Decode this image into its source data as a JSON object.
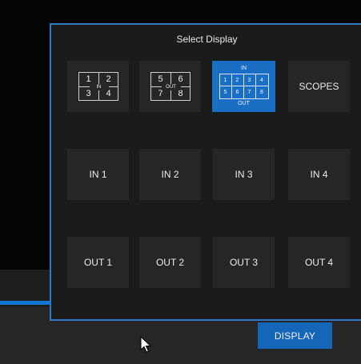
{
  "popup": {
    "title": "Select Display",
    "multiviews": [
      {
        "id": "in-quad",
        "center_label": "IN",
        "cells": [
          "1",
          "2",
          "3",
          "4"
        ],
        "selected": false
      },
      {
        "id": "out-quad",
        "center_label": "OUT",
        "cells": [
          "5",
          "6",
          "7",
          "8"
        ],
        "selected": false
      },
      {
        "id": "all-eight",
        "top_label": "IN",
        "bottom_label": "OUT",
        "cells": [
          "1",
          "2",
          "3",
          "4",
          "5",
          "6",
          "7",
          "8"
        ],
        "selected": true
      }
    ],
    "scopes_label": "SCOPES",
    "inputs": [
      "IN 1",
      "IN 2",
      "IN 3",
      "IN 4"
    ],
    "outputs": [
      "OUT 1",
      "OUT 2",
      "OUT 3",
      "OUT 4"
    ]
  },
  "toolbar": {
    "display_label": "DISPLAY"
  },
  "colors": {
    "accent": "#1a6fc4",
    "panel_border": "#2f79c4",
    "tile": "#262626",
    "panel_bg": "#1b1b1b"
  },
  "icons": {
    "cursor": "arrow-pointer-icon"
  }
}
